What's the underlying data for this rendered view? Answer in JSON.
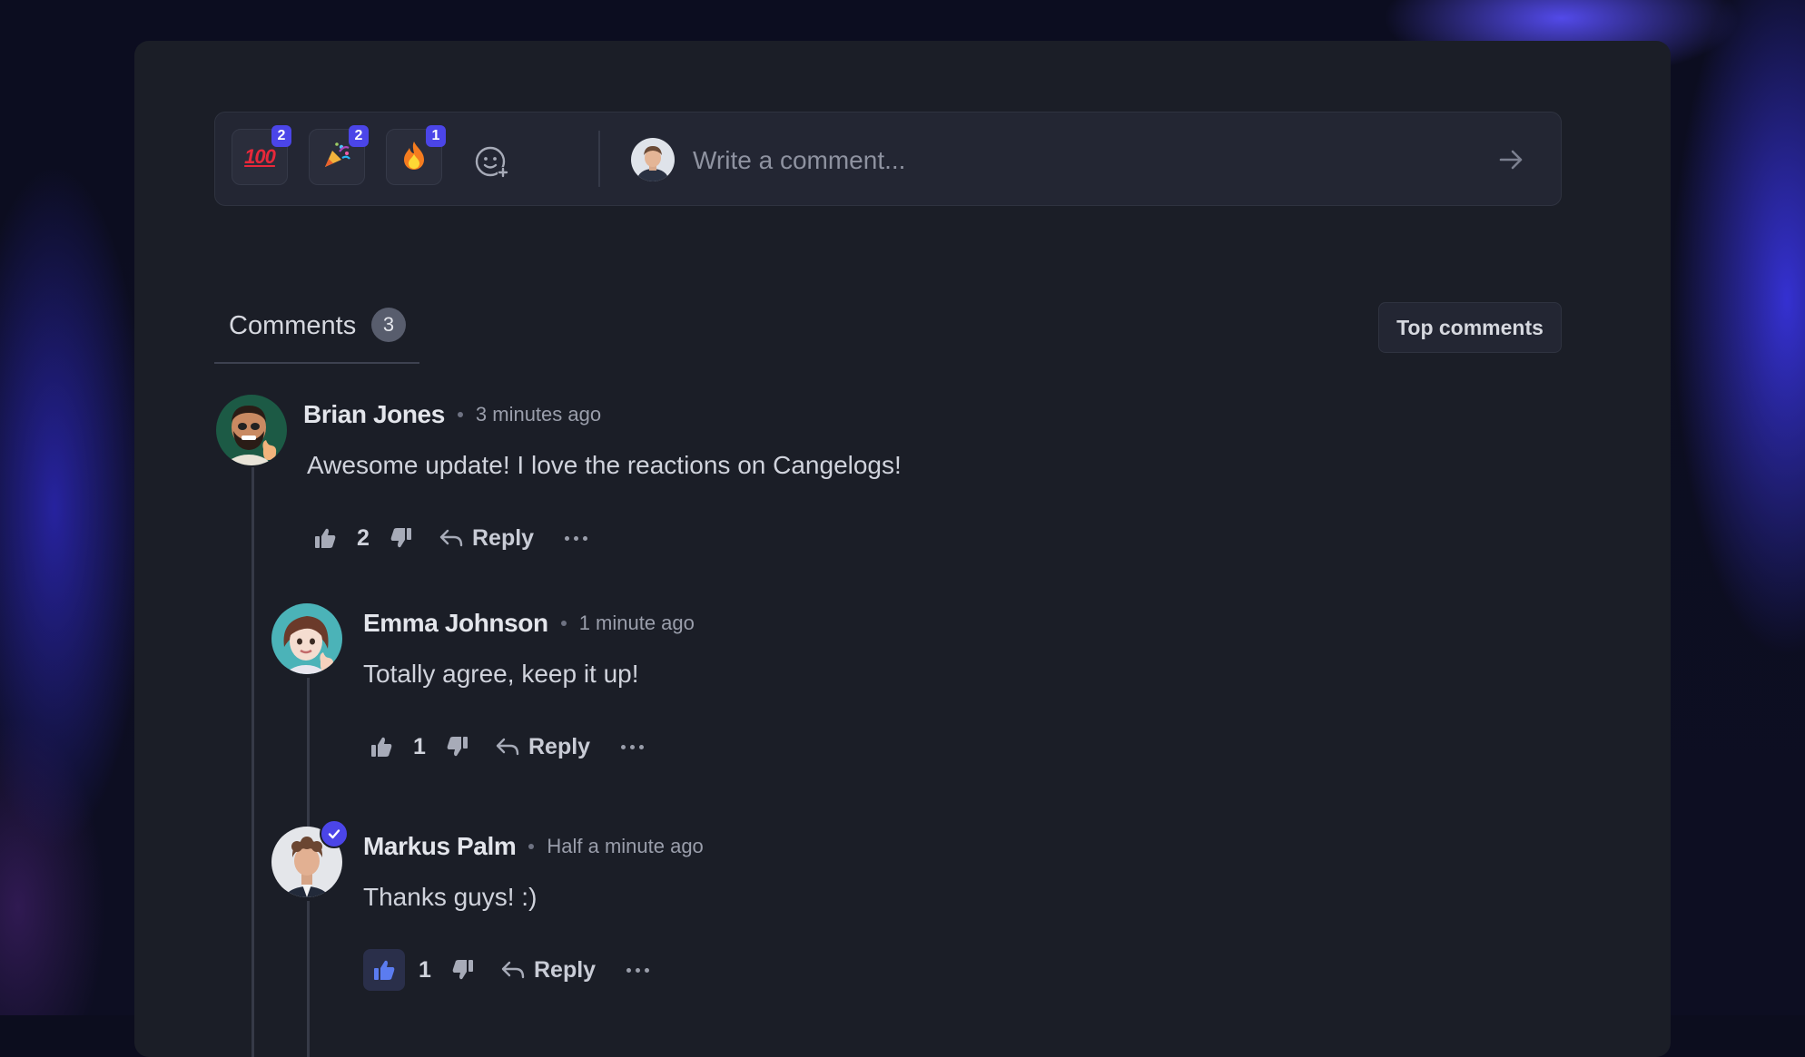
{
  "composer": {
    "reactions": [
      {
        "icon": "hundred-points-icon",
        "glyph": "100",
        "count": "2"
      },
      {
        "icon": "party-popper-icon",
        "glyph": "🎉",
        "count": "2"
      },
      {
        "icon": "fire-icon",
        "glyph": "🔥",
        "count": "1"
      }
    ],
    "placeholder": "Write a comment..."
  },
  "comments_tab": {
    "label": "Comments",
    "count": "3"
  },
  "sort": {
    "label": "Top comments"
  },
  "colors": {
    "accent": "#4b45e8",
    "panel": "#1b1e27",
    "liked": "#5b7cf0"
  },
  "comments": [
    {
      "author": "Brian Jones",
      "time": "3 minutes ago",
      "text": "Awesome update! I love the reactions on Cangelogs!",
      "likes": "2",
      "reply_label": "Reply"
    },
    {
      "author": "Emma Johnson",
      "time": "1 minute ago",
      "text": "Totally agree, keep it up!",
      "likes": "1",
      "reply_label": "Reply"
    },
    {
      "author": "Markus Palm",
      "time": "Half a minute ago",
      "text": "Thanks guys! :)",
      "likes": "1",
      "reply_label": "Reply",
      "liked_by_me": true,
      "verified": true
    }
  ]
}
